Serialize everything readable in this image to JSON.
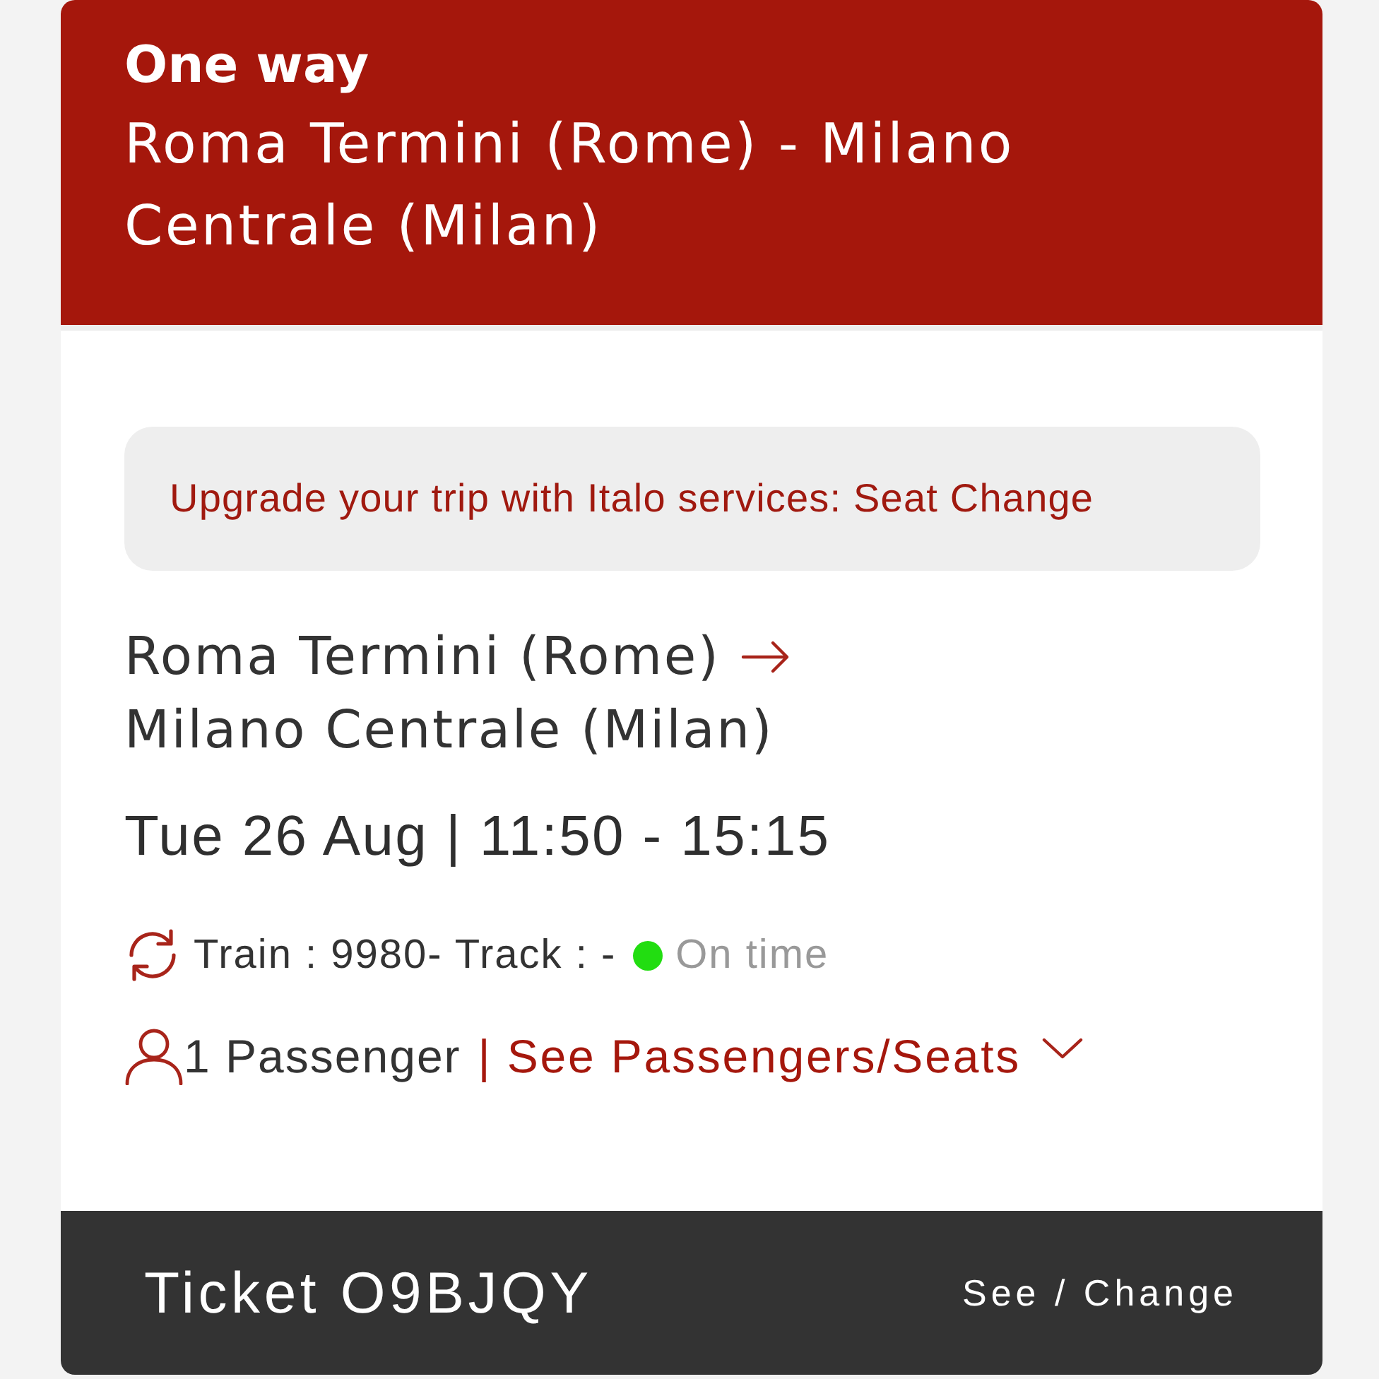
{
  "header": {
    "trip_type": "One way",
    "route": "Roma Termini (Rome) - Milano Centrale (Milan)"
  },
  "upgrade_banner": {
    "text": "Upgrade your trip with Italo services: Seat Change"
  },
  "journey": {
    "origin": "Roma Termini (Rome)",
    "destination": "Milano Centrale (Milan)",
    "schedule": "Tue 26 Aug | 11:50 - 15:15",
    "train_info": "Train : 9980- Track : -",
    "status": {
      "label": "On time",
      "color": "#22dd11"
    },
    "passengers": "1 Passenger",
    "passengers_link": "| See Passengers/Seats",
    "passengers_expanded": false
  },
  "footer": {
    "ticket": "Ticket O9BJQY",
    "action": "See / Change"
  }
}
